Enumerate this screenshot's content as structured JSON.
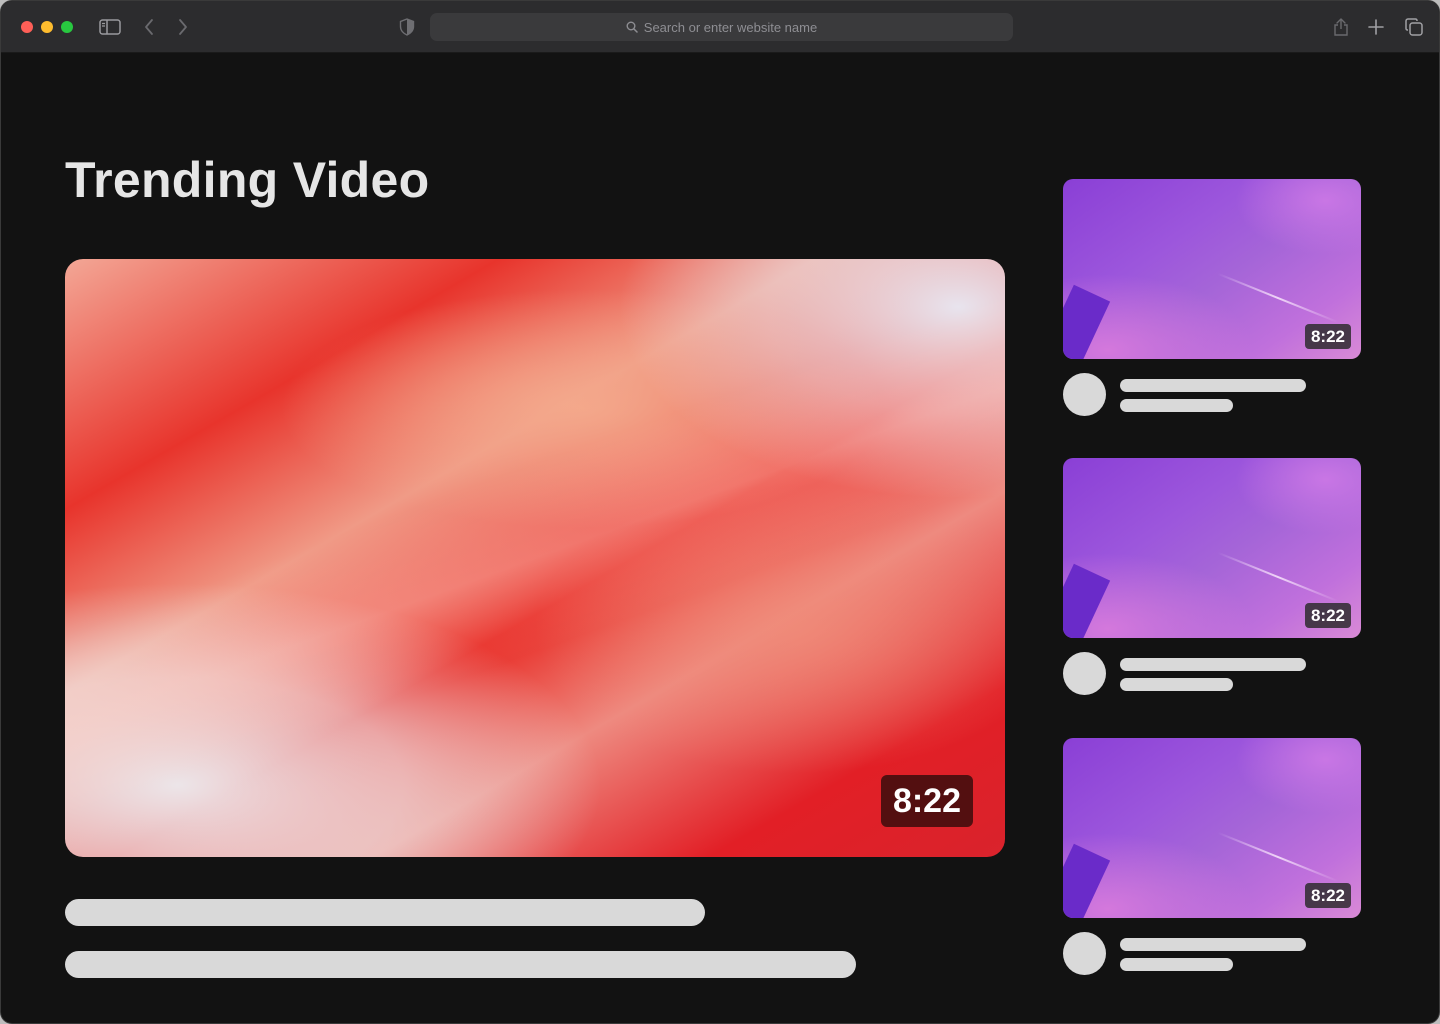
{
  "browser": {
    "address_placeholder": "Search or enter website name"
  },
  "page": {
    "title": "Trending Video"
  },
  "main_video": {
    "duration": "8:22"
  },
  "side_videos": [
    {
      "duration": "8:22"
    },
    {
      "duration": "8:22"
    },
    {
      "duration": "8:22"
    }
  ],
  "icons": {
    "sidebar": "sidebar-toggle-icon",
    "back": "chevron-left-icon",
    "forward": "chevron-right-icon",
    "privacy": "shield-icon",
    "search": "search-icon",
    "share": "share-icon",
    "new_tab": "plus-icon",
    "tabs": "tab-overview-icon"
  },
  "colors": {
    "background": "#121212",
    "toolbar": "#2c2c2e",
    "skeleton": "#d9d9d9"
  }
}
